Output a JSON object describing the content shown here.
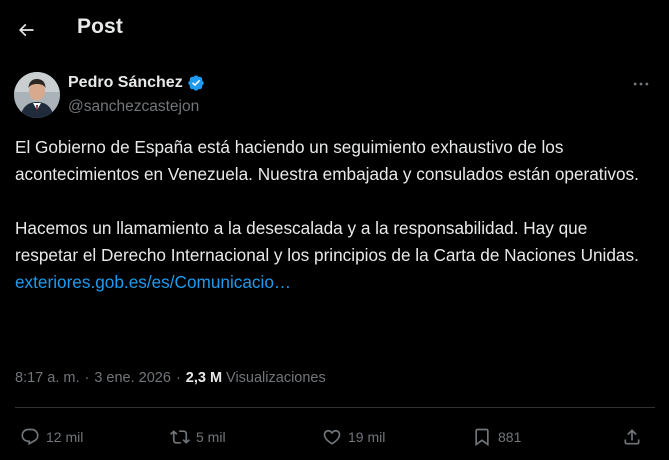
{
  "header": {
    "title": "Post",
    "back_icon": "arrow-left-icon"
  },
  "author": {
    "name": "Pedro Sánchez",
    "handle": "@sanchezcastejon",
    "verified_icon": "verified-badge-icon",
    "verified_color": "#1d9bf0"
  },
  "post": {
    "paragraph1": "El Gobierno de España está haciendo un seguimiento exhaustivo de los acontecimientos en Venezuela. Nuestra embajada y consulados están operativos.",
    "paragraph2": "Hacemos un llamamiento a la desescalada y a la responsabilidad. Hay que respetar el Derecho Internacional y los principios de la Carta de Naciones Unidas.",
    "link_text": "exteriores.gob.es/es/Comunicacio…"
  },
  "meta": {
    "time": "8:17 a. m.",
    "separator": "·",
    "date": "3 ene. 2026",
    "views_count": "2,3 M",
    "views_label": "Visualizaciones"
  },
  "actions": {
    "replies": "12 mil",
    "reposts": "5 mil",
    "likes": "19 mil",
    "bookmarks": "881"
  },
  "colors": {
    "background": "#000000",
    "text": "#e7e9ea",
    "secondary": "#71767b",
    "link": "#1d9bf0",
    "divider": "#2f3336"
  }
}
